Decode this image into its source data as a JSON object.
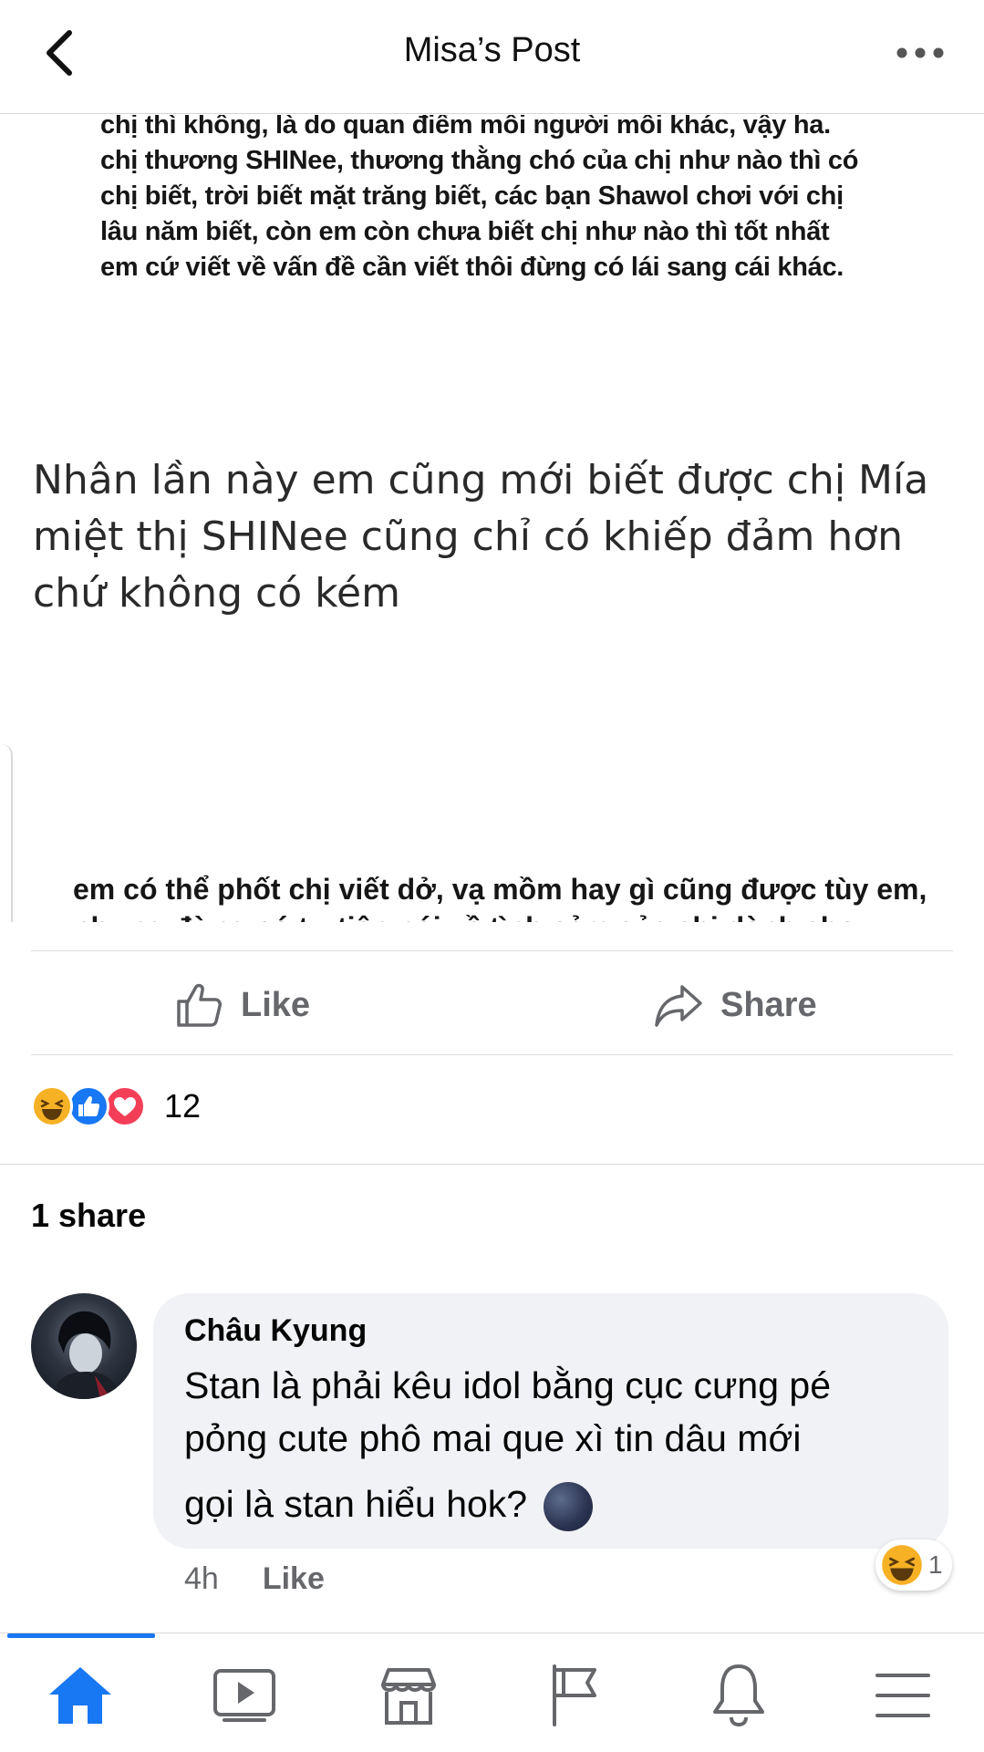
{
  "header": {
    "title": "Misa’s Post"
  },
  "post_image": {
    "top_paragraph": [
      "chị thì không, là do quan điểm mỗi người mỗi khác, vậy ha.",
      "chị thương SHINee, thương thằng chó của chị như nào thì có",
      "chị biết, trời biết mặt trăng biết, các bạn Shawol chơi với chị",
      "lâu năm biết, còn em còn chưa biết chị như nào thì tốt nhất",
      "em cứ viết về vấn đề cần viết thôi đừng có lái sang cái khác."
    ],
    "middle_text": [
      "Nhân lần này em cũng mới biết được chị Mía",
      "miệt thị SHINee cũng chỉ có khiếp đảm hơn",
      "chứ không có kém"
    ],
    "bottom_paragraph": [
      "em có thể phốt chị viết dở, vạ mồm hay gì cũng được tùy em,",
      "nhưng đừng có tự tiện nói về tình cảm của chị dành cho"
    ]
  },
  "actions": {
    "like_label": "Like",
    "share_label": "Share"
  },
  "reactions": {
    "count": "12",
    "types": [
      "haha",
      "like",
      "love"
    ]
  },
  "shares_text": "1 share",
  "comment": {
    "author": "Châu Kyung",
    "text_lines": [
      "Stan là phải kêu idol bằng cục cưng pé",
      "pỏng cute phô mai que xì tin dâu mới",
      "gọi là stan hiểu hok?"
    ],
    "emoji": "new-moon-face",
    "time": "4h",
    "like_label": "Like",
    "reaction_count": "1",
    "reaction_type": "haha"
  },
  "bottom_nav": {
    "items": [
      "home",
      "watch",
      "marketplace",
      "pages",
      "notifications",
      "menu"
    ],
    "active": "home",
    "active_color": "#1877f2"
  },
  "colors": {
    "brand": "#1877f2",
    "secondary_text": "#65676b",
    "bubble_bg": "#f0f2f5",
    "love": "#f33e58",
    "haha": "#f7b125"
  }
}
